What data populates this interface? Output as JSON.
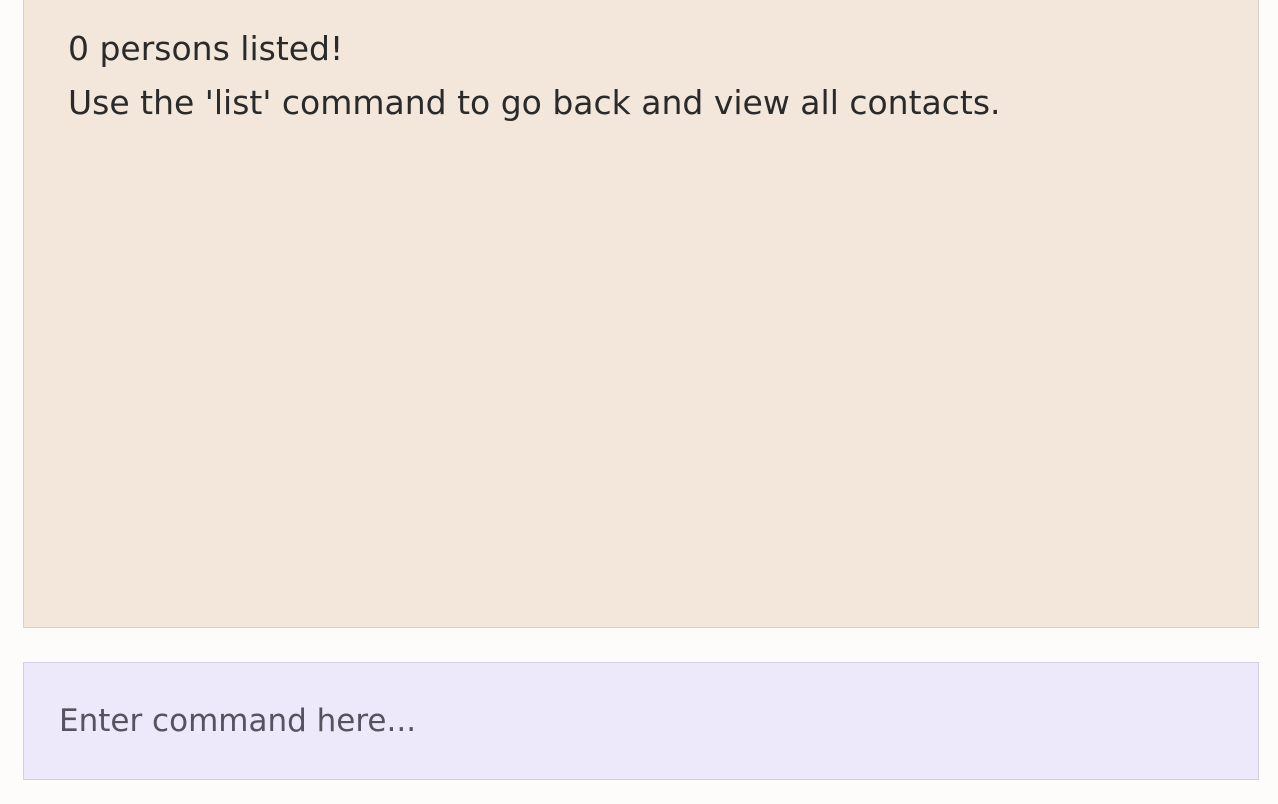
{
  "result_display": {
    "lines": [
      "0 persons listed!",
      "Use the 'list' command to go back and view all contacts."
    ]
  },
  "command_box": {
    "value": "",
    "placeholder": "Enter command here..."
  },
  "colors": {
    "result_background": "#f3e7db",
    "command_background": "#ede8fa",
    "page_background": "#fdfcfb",
    "text": "#2a2a2a"
  }
}
